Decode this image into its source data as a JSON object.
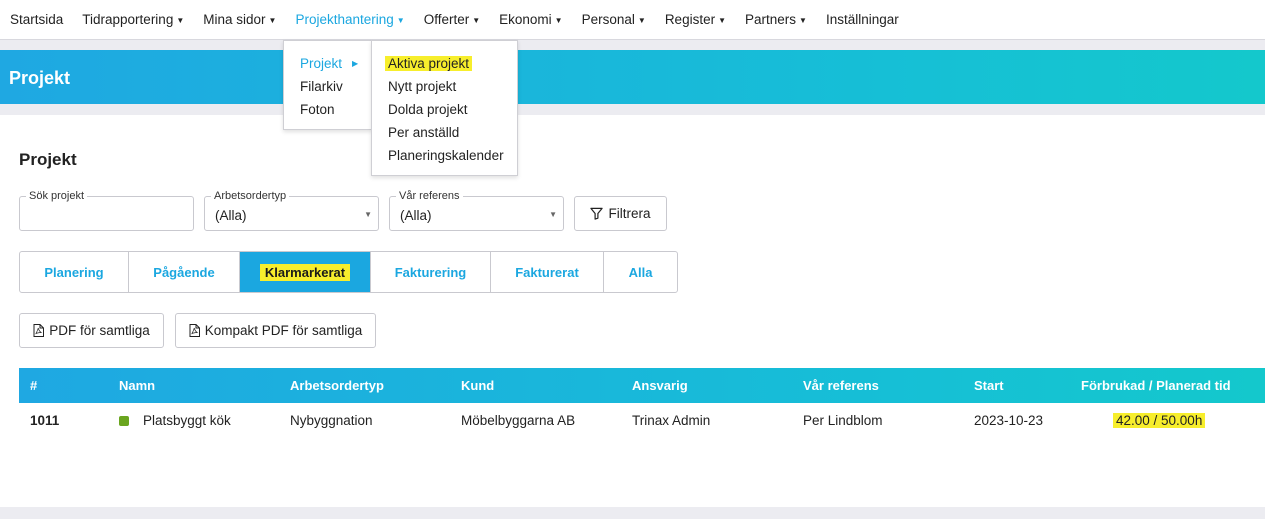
{
  "nav": {
    "items": [
      {
        "label": "Startsida",
        "caret": false
      },
      {
        "label": "Tidrapportering",
        "caret": true
      },
      {
        "label": "Mina sidor",
        "caret": true
      },
      {
        "label": "Projekthantering",
        "caret": true,
        "active": true
      },
      {
        "label": "Offerter",
        "caret": true
      },
      {
        "label": "Ekonomi",
        "caret": true
      },
      {
        "label": "Personal",
        "caret": true
      },
      {
        "label": "Register",
        "caret": true
      },
      {
        "label": "Partners",
        "caret": true
      },
      {
        "label": "Inställningar",
        "caret": false
      }
    ]
  },
  "header": {
    "title": "Projekt"
  },
  "main": {
    "title": "Projekt",
    "filters": {
      "search": {
        "label": "Sök projekt",
        "value": ""
      },
      "work_order_type": {
        "label": "Arbetsordertyp",
        "value": "(Alla)"
      },
      "our_reference": {
        "label": "Vår referens",
        "value": "(Alla)"
      },
      "filter_button": "Filtrera"
    },
    "tabs": [
      {
        "label": "Planering"
      },
      {
        "label": "Pågående"
      },
      {
        "label": "Klarmarkerat",
        "active": true
      },
      {
        "label": "Fakturering"
      },
      {
        "label": "Fakturerat"
      },
      {
        "label": "Alla"
      }
    ],
    "pdf_buttons": {
      "pdf_all": "PDF för samtliga",
      "compact_pdf_all": "Kompakt PDF för samtliga"
    },
    "table": {
      "headers": {
        "id": "#",
        "name": "Namn",
        "work_order_type": "Arbetsordertyp",
        "customer": "Kund",
        "responsible": "Ansvarig",
        "our_reference": "Vår referens",
        "start": "Start",
        "time": "Förbrukad / Planerad tid"
      },
      "rows": [
        {
          "id": "1011",
          "name": "Platsbyggt kök",
          "status_color": "#6aa51f",
          "work_order_type": "Nybyggnation",
          "customer": "Möbelbyggarna AB",
          "responsible": "Trinax Admin",
          "our_reference": "Per Lindblom",
          "start": "2023-10-23",
          "time": "42.00 / 50.00h"
        }
      ]
    }
  },
  "dropdown": {
    "level1": [
      {
        "label": "Projekt",
        "active": true
      },
      {
        "label": "Filarkiv"
      },
      {
        "label": "Foton"
      }
    ],
    "level2": [
      {
        "label": "Aktiva projekt",
        "highlighted": true
      },
      {
        "label": "Nytt projekt"
      },
      {
        "label": "Dolda projekt"
      },
      {
        "label": "Per anställd"
      },
      {
        "label": "Planeringskalender"
      }
    ]
  },
  "colors": {
    "accent": "#1ba7e0",
    "gradient_end": "#14c8cc",
    "highlight": "#f7ee2c"
  }
}
